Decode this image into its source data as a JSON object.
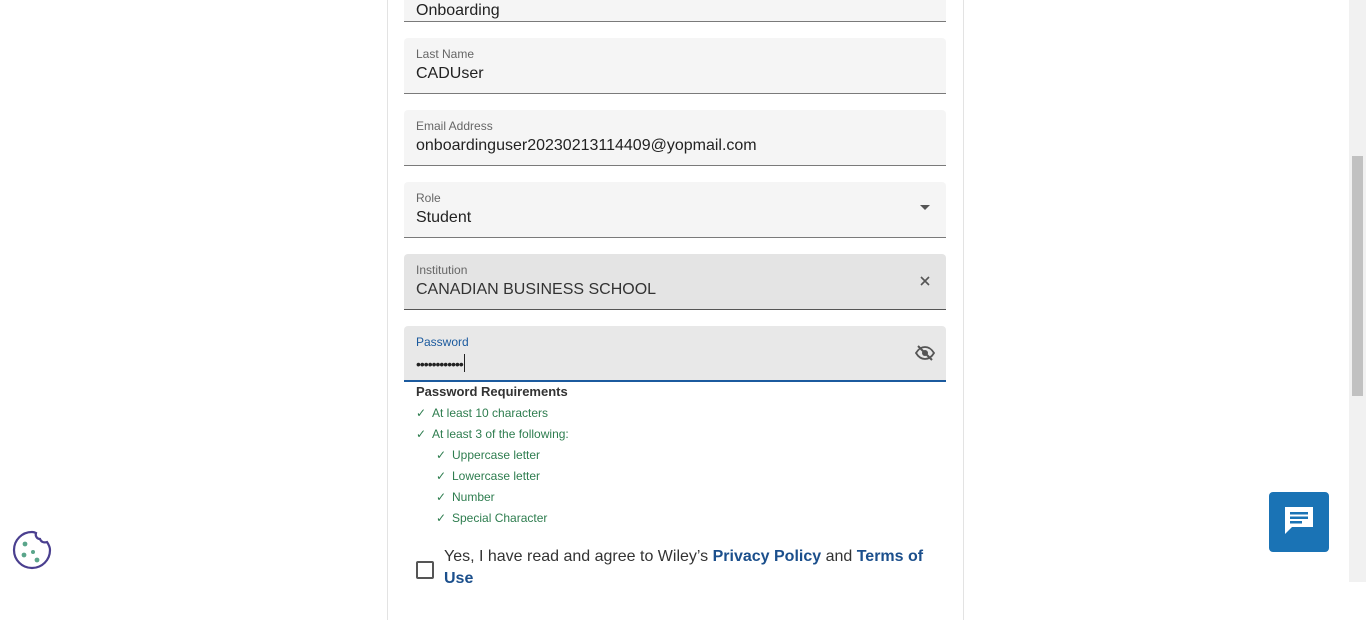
{
  "form": {
    "first_name": {
      "value": "Onboarding"
    },
    "last_name": {
      "label": "Last Name",
      "value": "CADUser"
    },
    "email": {
      "label": "Email Address",
      "value": "onboardinguser20230213114409@yopmail.com"
    },
    "role": {
      "label": "Role",
      "value": "Student"
    },
    "institution": {
      "label": "Institution",
      "value": "CANADIAN BUSINESS SCHOOL"
    },
    "password": {
      "label": "Password",
      "value": "••••••••••••"
    }
  },
  "requirements": {
    "title": "Password Requirements",
    "items": [
      "At least 10 characters",
      "At least 3 of the following:",
      "Uppercase letter",
      "Lowercase letter",
      "Number",
      "Special Character"
    ]
  },
  "agreement": {
    "prefix": "Yes, I have read and agree to Wiley’s ",
    "privacy_link": "Privacy Policy",
    "and": " and ",
    "terms_link": "Terms of Use"
  },
  "colors": {
    "accent": "#1b5a9e",
    "success": "#2e7d4f",
    "chat_button": "#1a73b5"
  },
  "icons": {
    "role_dropdown": "caret-down-icon",
    "institution_clear": "close-icon",
    "password_toggle": "eye-off-icon",
    "chat": "chat-icon",
    "cookie": "cookie-icon"
  }
}
